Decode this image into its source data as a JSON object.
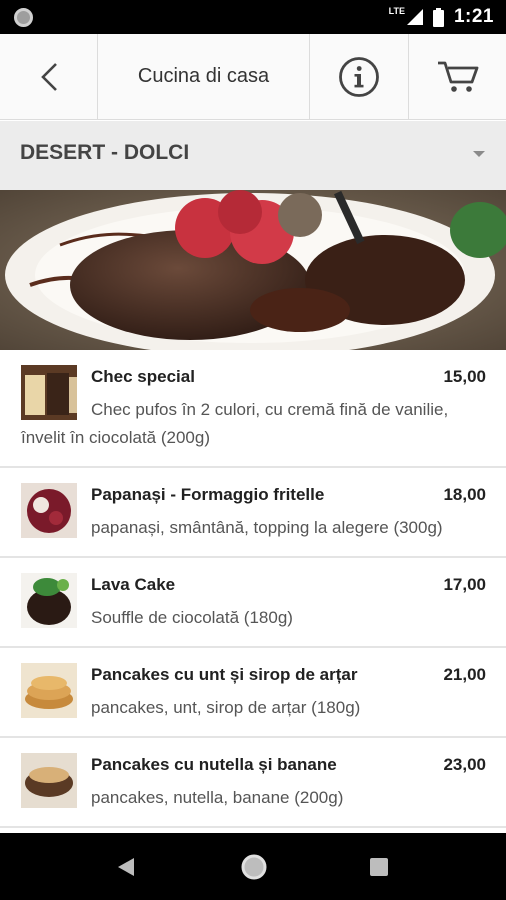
{
  "status_bar": {
    "network": "LTE",
    "time": "1:21",
    "icons": [
      "notification-dot-icon",
      "signal-icon",
      "battery-icon"
    ]
  },
  "app_bar": {
    "title": "Cucina di casa",
    "icons": [
      "back-arrow-icon",
      "info-icon",
      "cart-icon"
    ]
  },
  "category": {
    "selected": "DESERT - DOLCI"
  },
  "menu": {
    "items": [
      {
        "name": "Chec special",
        "price": "15,00",
        "description": "Chec pufos în 2 culori, cu cremă fină de vanilie, învelit în ciocolată (200g)"
      },
      {
        "name": "Papanași - Formaggio fritelle",
        "price": "18,00",
        "description": "papanași, smântână, topping la alegere (300g)"
      },
      {
        "name": "Lava Cake",
        "price": "17,00",
        "description": "Souffle de ciocolată (180g)"
      },
      {
        "name": "Pancakes cu unt și sirop de arțar",
        "price": "21,00",
        "description": "pancakes, unt, sirop de arțar (180g)"
      },
      {
        "name": "Pancakes cu nutella și banane",
        "price": "23,00",
        "description": "pancakes, nutella, banane (200g)"
      }
    ]
  },
  "nav_bar": {
    "icons": [
      "nav-back-icon",
      "nav-home-icon",
      "nav-recents-icon"
    ]
  },
  "colors": {
    "app_bar_bg": "#fafafa",
    "category_bg": "#ececec",
    "divider": "#e4e4e4"
  }
}
